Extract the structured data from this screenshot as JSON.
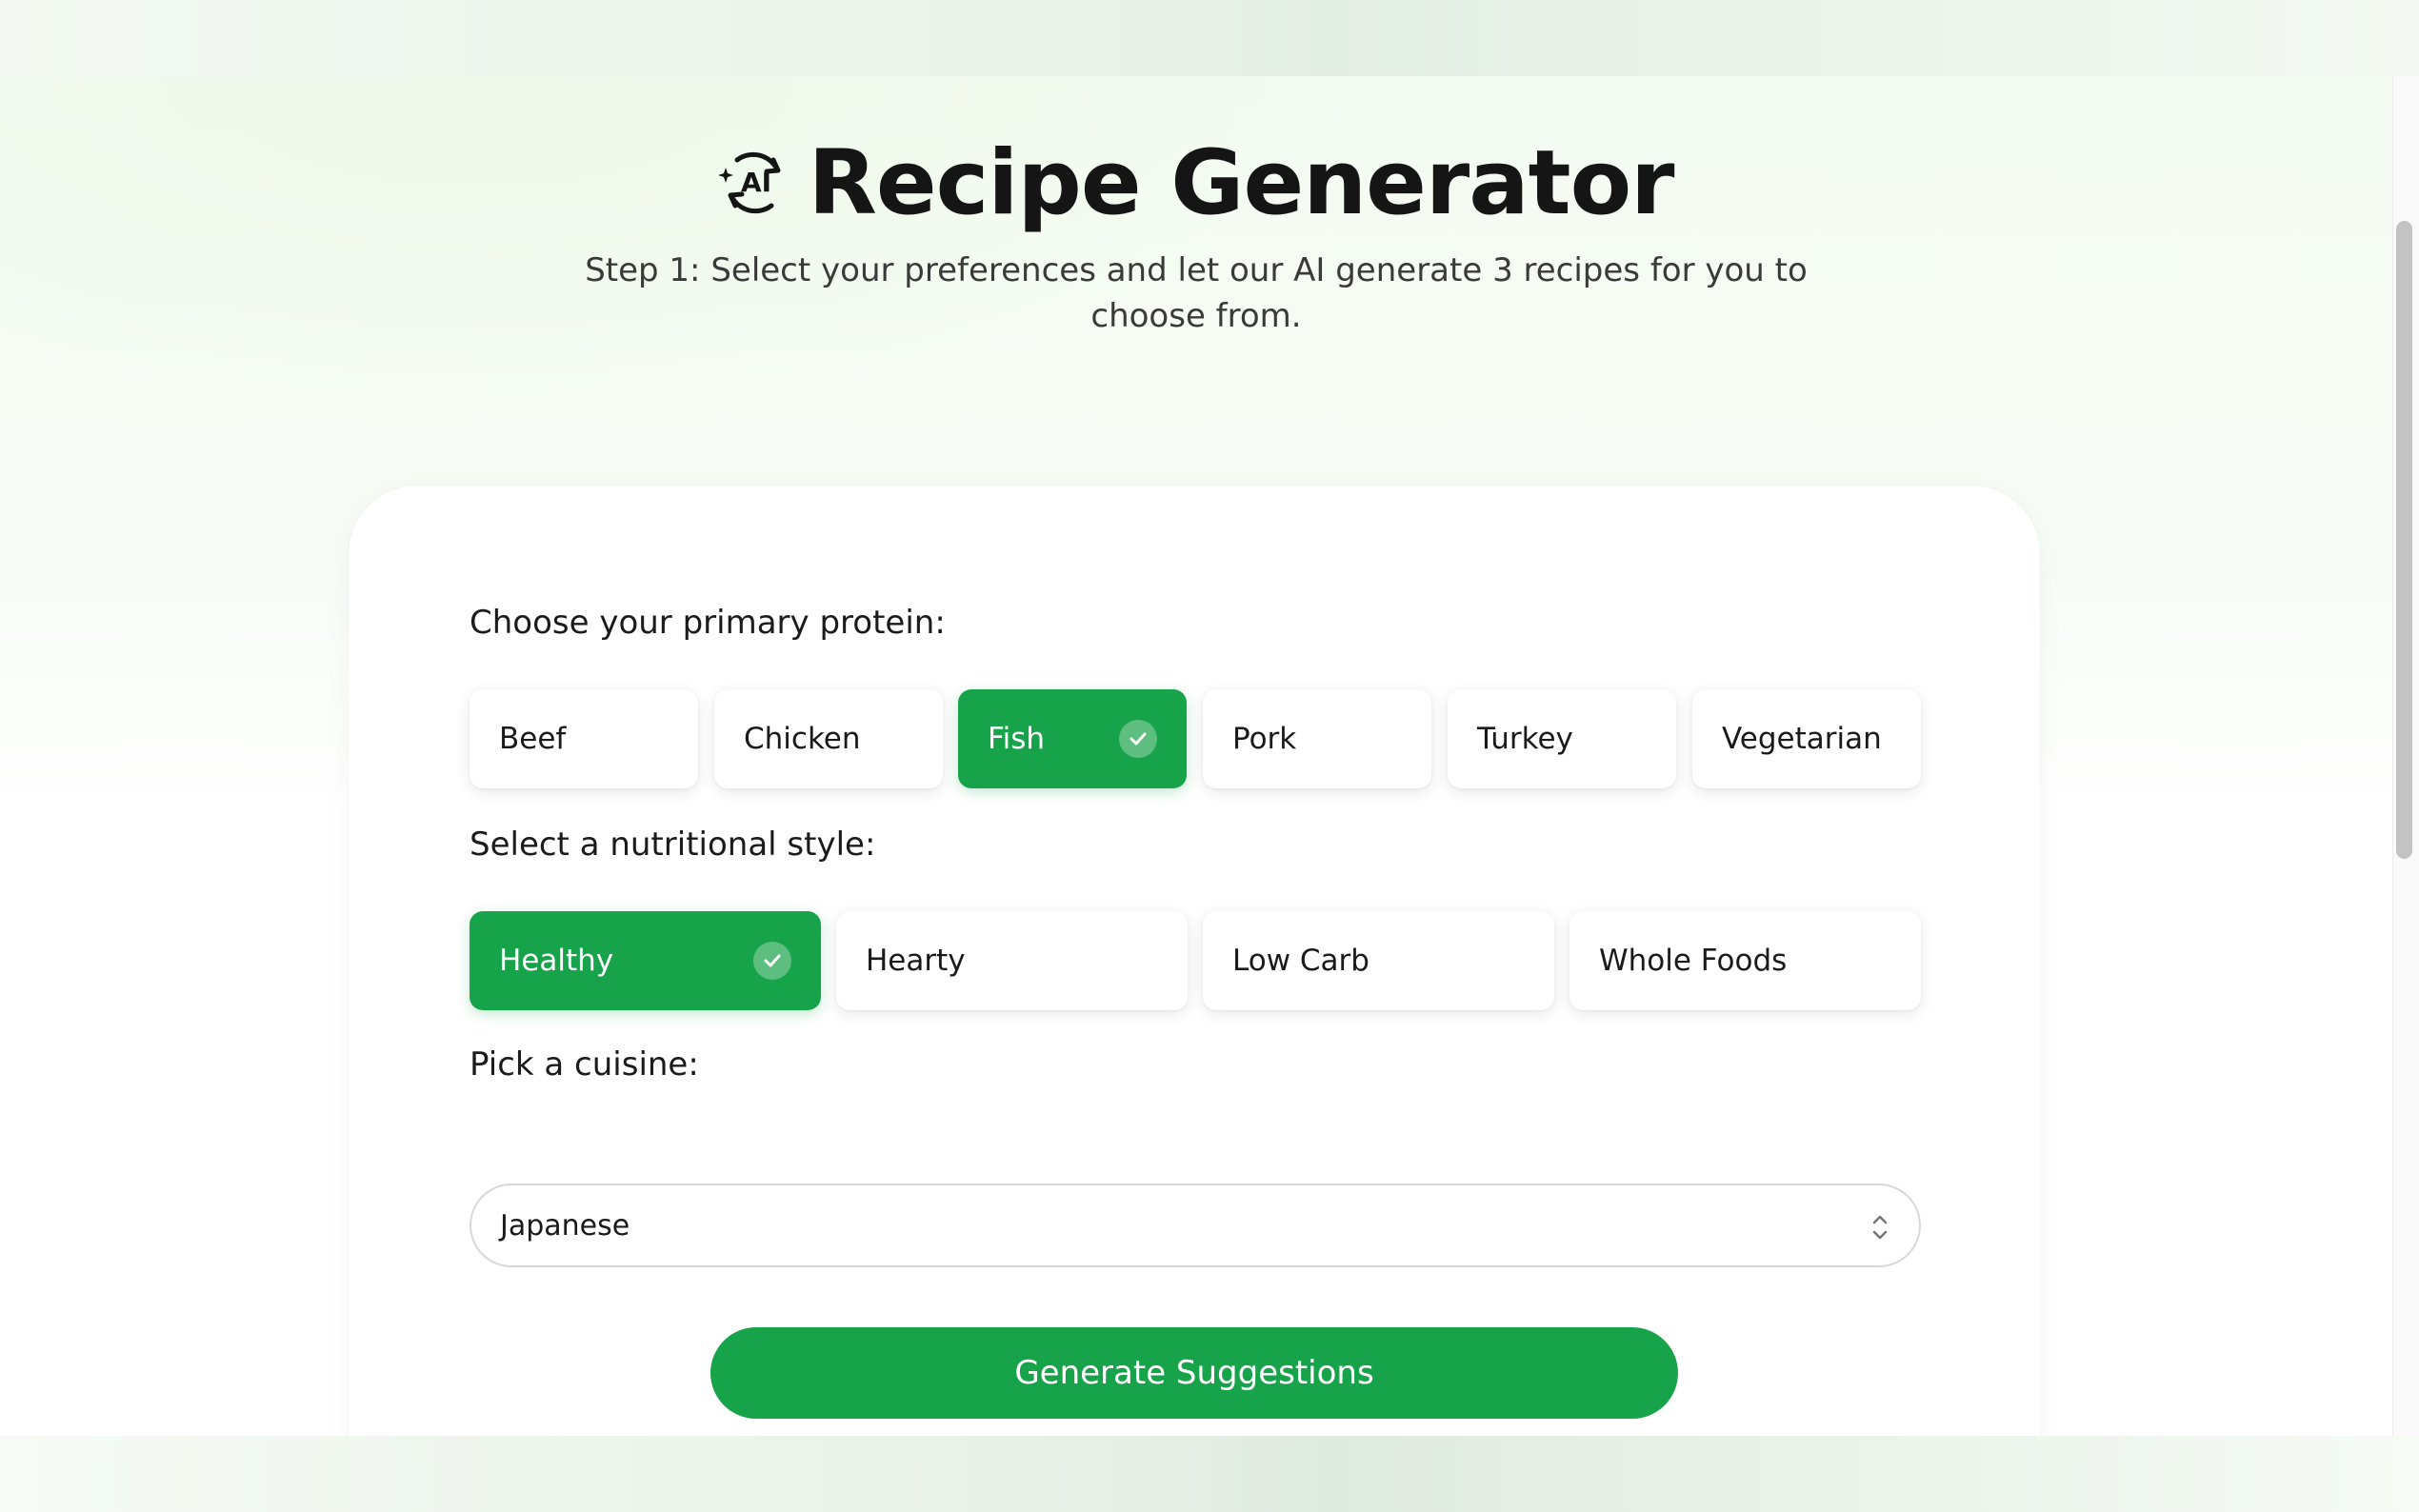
{
  "header": {
    "title": "Recipe Generator",
    "subtitle": "Step 1: Select your preferences and let our AI generate 3 recipes for you to choose from.",
    "icon": "ai-refresh-icon"
  },
  "form": {
    "protein_label": "Choose your primary protein:",
    "proteins": [
      {
        "label": "Beef",
        "selected": false
      },
      {
        "label": "Chicken",
        "selected": false
      },
      {
        "label": "Fish",
        "selected": true
      },
      {
        "label": "Pork",
        "selected": false
      },
      {
        "label": "Turkey",
        "selected": false
      },
      {
        "label": "Vegetarian",
        "selected": false
      }
    ],
    "style_label": "Select a nutritional style:",
    "styles": [
      {
        "label": "Healthy",
        "selected": true
      },
      {
        "label": "Hearty",
        "selected": false
      },
      {
        "label": "Low Carb",
        "selected": false
      },
      {
        "label": "Whole Foods",
        "selected": false
      }
    ],
    "cuisine_label": "Pick a cuisine:",
    "cuisine_value": "Japanese",
    "generate_label": "Generate Suggestions"
  },
  "colors": {
    "accent": "#17a34a",
    "background_tint": "#f4fbf1"
  }
}
